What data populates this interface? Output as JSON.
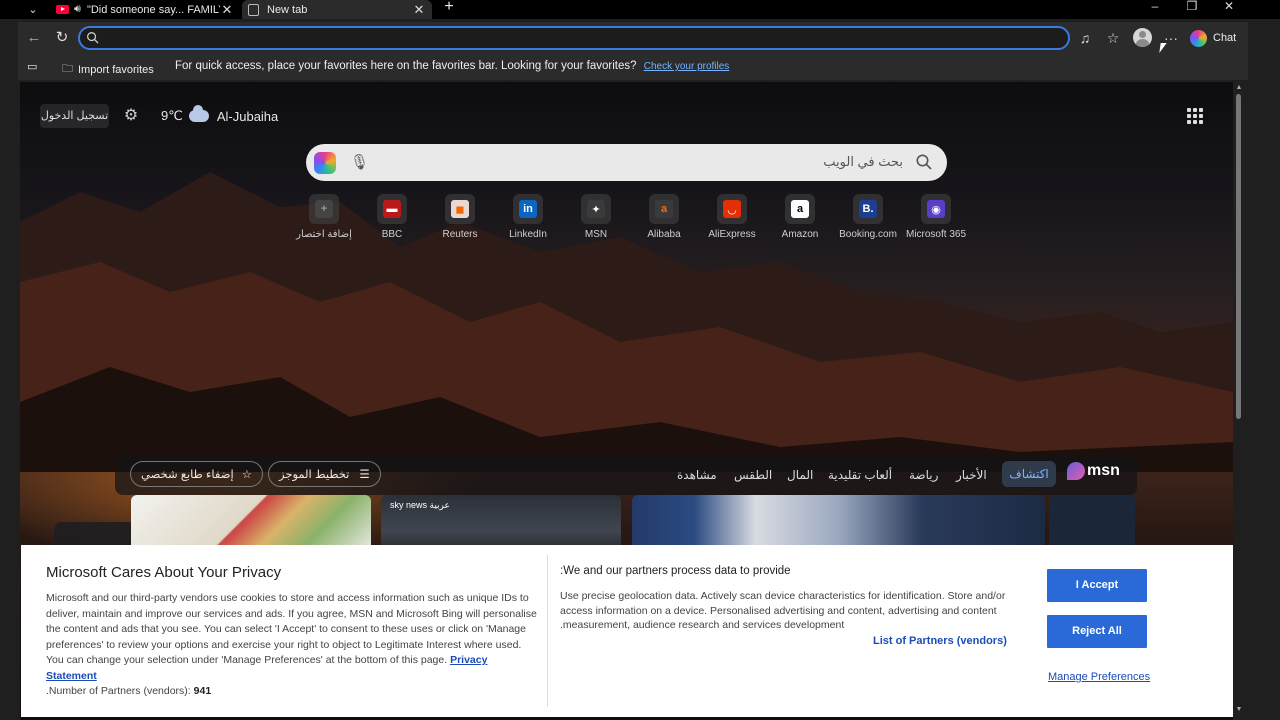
{
  "tabs": [
    {
      "title": "\"Did someone say... FAMILY?\""
    },
    {
      "title": "New tab"
    }
  ],
  "toolbar": {
    "address_value": "",
    "copilot_label": "Chat"
  },
  "favorites_bar": {
    "import_label": "Import favorites",
    "prompt": "For quick access, place your favorites here on the favorites bar. Looking for your favorites?",
    "link": "Check your profiles"
  },
  "ntp": {
    "signin": "تسجيل الدخول",
    "temperature": "9℃",
    "location": "Al-Jubaiha",
    "search_placeholder": "بحث في الويب",
    "tiles": [
      {
        "label": "إضافة اختصار",
        "icon": "add-icon",
        "glyph": "+",
        "bg": "#444444",
        "fg": "#999999"
      },
      {
        "label": "BBC",
        "icon": "bbc-icon",
        "glyph": "▬",
        "bg": "#bb1919",
        "fg": "#ffffff"
      },
      {
        "label": "Reuters",
        "icon": "reuters-icon",
        "glyph": "◼",
        "bg": "#e8d9d2",
        "fg": "#fa6400"
      },
      {
        "label": "LinkedIn",
        "icon": "linkedin-icon",
        "glyph": "in",
        "bg": "#0a66c2",
        "fg": "#ffffff"
      },
      {
        "label": "MSN",
        "icon": "msn-icon",
        "glyph": "✦",
        "bg": "#3a3a3a",
        "fg": "#ffffff"
      },
      {
        "label": "Alibaba",
        "icon": "alibaba-icon",
        "glyph": "a",
        "bg": "#3a3a3a",
        "fg": "#ff6a00"
      },
      {
        "label": "AliExpress",
        "icon": "aliexpress-icon",
        "glyph": "◡",
        "bg": "#e62e04",
        "fg": "#ffffff"
      },
      {
        "label": "Amazon",
        "icon": "amazon-icon",
        "glyph": "a",
        "bg": "#ffffff",
        "fg": "#000000"
      },
      {
        "label": "Booking.com",
        "icon": "booking-icon",
        "glyph": "B.",
        "bg": "#1c3f8f",
        "fg": "#ffffff"
      },
      {
        "label": "Microsoft 365",
        "icon": "m365-icon",
        "glyph": "◉",
        "bg": "#5b3ec8",
        "fg": "#ffffff"
      }
    ],
    "feed": {
      "personalize_label": "إضفاء طابع شخصي",
      "layout_label": "تخطيط الموجز",
      "nav": [
        "مشاهدة",
        "الطقس",
        "المال",
        "ألعاب تقليدية",
        "رياضة",
        "الأخبار"
      ],
      "active": "اكتشاف",
      "brand": "msn",
      "card2_source": "sky news عربية"
    }
  },
  "consent": {
    "title": "Microsoft Cares About Your Privacy",
    "body": "Microsoft and our third-party vendors use cookies to store and access information such as unique IDs to deliver, maintain and improve our services and ads. If you agree, MSN and Microsoft Bing will personalise the content and ads that you see. You can select 'I Accept' to consent to these uses or click on 'Manage preferences' to review your options and exercise your right to object to Legitimate Interest where used. You can change your selection under 'Manage Preferences' at the bottom of this page.",
    "privacy_link": "Privacy Statement",
    "partners_count_label": ".Number of Partners (vendors):",
    "partners_count": "941",
    "heading2": ":We and our partners process data to provide",
    "body2": "Use precise geolocation data. Actively scan device characteristics for identification. Store and/or access information on a device. Personalised advertising and content, advertising and content .measurement, audience research and services development",
    "partners_link": "List of Partners (vendors)",
    "accept": "I Accept",
    "reject": "Reject All",
    "manage": "Manage Preferences"
  },
  "colors": {
    "accent": "#2a6ad8",
    "link": "#1a4cb8",
    "address_focus": "#3b7ae0"
  }
}
